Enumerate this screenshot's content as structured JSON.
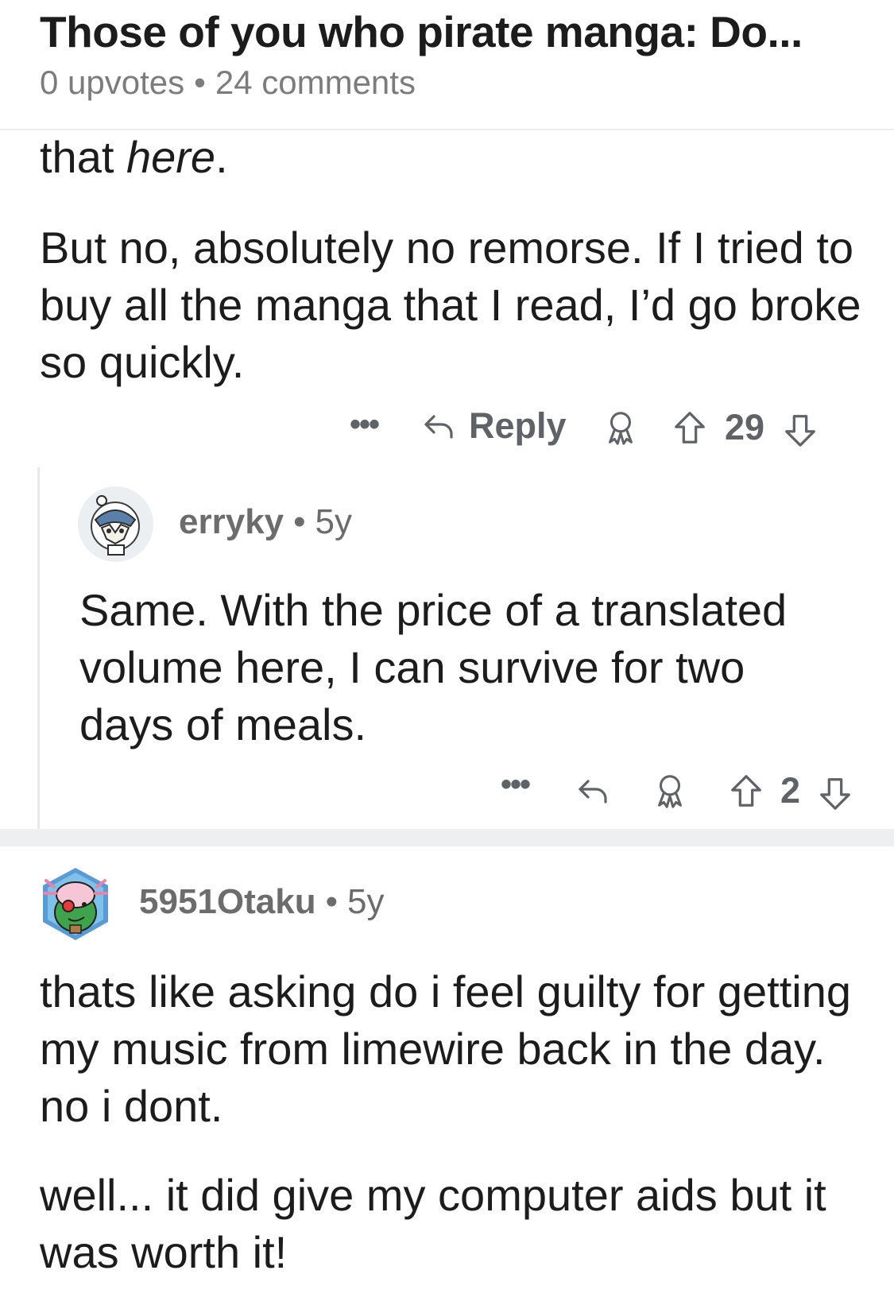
{
  "post": {
    "title": "Those of you who pirate manga: Do...",
    "upvotes": "0 upvotes",
    "comments": "24 comments"
  },
  "comment1": {
    "text_prefix": "that ",
    "text_italic": "here",
    "text_suffix": ".",
    "paragraph2": "But no, absolutely no remorse. If I tried to buy all the manga that I read, I’d go broke so quickly.",
    "reply_label": "Reply",
    "votes": "29"
  },
  "comment2": {
    "username": "erryky",
    "age": "5y",
    "text": "Same. With the price of a translated volume here, I can survive for two days of meals.",
    "votes": "2"
  },
  "comment3": {
    "username": "5951Otaku",
    "age": "5y",
    "paragraph1": "thats like asking do i feel guilty for getting my music from limewire back in the day. no i dont.",
    "paragraph2": "well... it did give my computer aids but it was worth it!"
  },
  "icons": {
    "more": "more-options-icon",
    "reply": "reply-arrow-icon",
    "award": "award-icon",
    "upvote": "upvote-arrow-icon",
    "downvote": "downvote-arrow-icon"
  },
  "colors": {
    "text": "#1c1c1c",
    "meta": "#7c7c7c",
    "action": "#5f6368",
    "separator": "#edeff1"
  }
}
